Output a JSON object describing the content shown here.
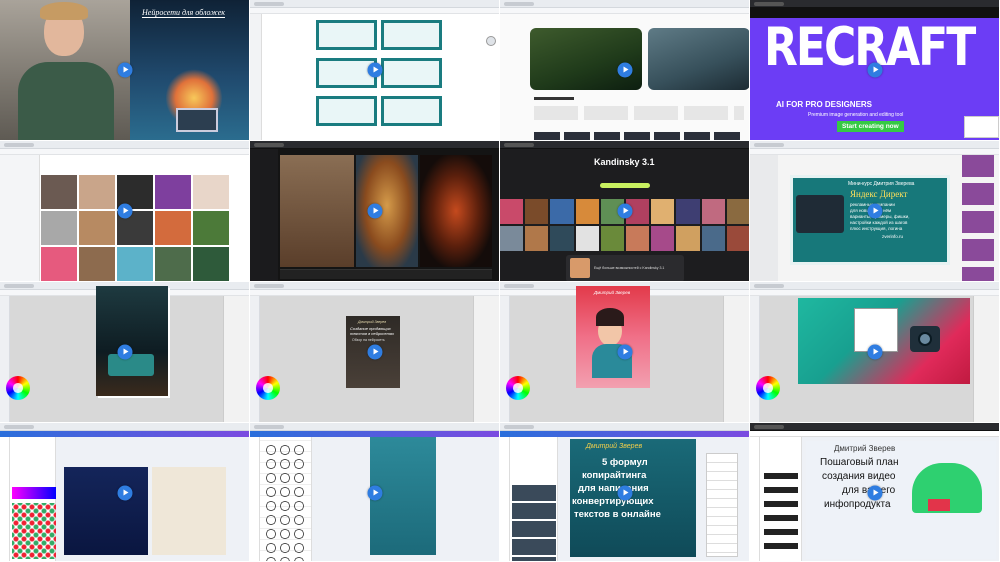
{
  "tiles": {
    "t1": {
      "title": "Нейросети для обложек"
    },
    "t4": {
      "logo": "RECRAFT",
      "headline": "AI FOR PRO DESIGNERS",
      "subline": "Premium image generation and editing tool",
      "cta": "Start creating now"
    },
    "t7": {
      "title": "Kandinsky 3.1",
      "card_title": "Ещё больше возможностей с Kandinsky 3.1"
    },
    "t8": {
      "heading": "Мини-курс Дмитрия Зверева",
      "brand": "Яндекс Директ",
      "line1": "рекламные кампании",
      "line2": "для новичков в нём",
      "line3": "варианты, примеры, фишки,",
      "line4": "настройки каждой из шагов",
      "line5": "плюс инструкция, логина",
      "line6": "zverinfo.ru"
    },
    "t10": {
      "line1": "Дмитрий Зверев",
      "line2": "Создание продающих",
      "line3": "текстов в нейросетях",
      "line4": "Обзор на нейросеть"
    },
    "t11": {
      "author": "Дмитрий Зверев"
    },
    "t15": {
      "author": "Дмитрий Зверев",
      "line1": "5 формул",
      "line2": "копирайтинга",
      "line3": "для написания",
      "line4": "конвертирующих",
      "line5": "текстов в онлайне"
    },
    "t16": {
      "author": "Дмитрий Зверев",
      "line1": "Пошаговый план",
      "line2": "создания видео",
      "line3": "для вашего",
      "line4": "инфопродукта"
    }
  },
  "colors": {
    "play": "#2f7de1",
    "recraft_bg": "#6c3df5",
    "recraft_cta": "#35c944",
    "teal": "#17787a",
    "kandinsky_bg": "#1d1d1f"
  },
  "icons": [
    "play-icon",
    "color-wheel-icon"
  ]
}
